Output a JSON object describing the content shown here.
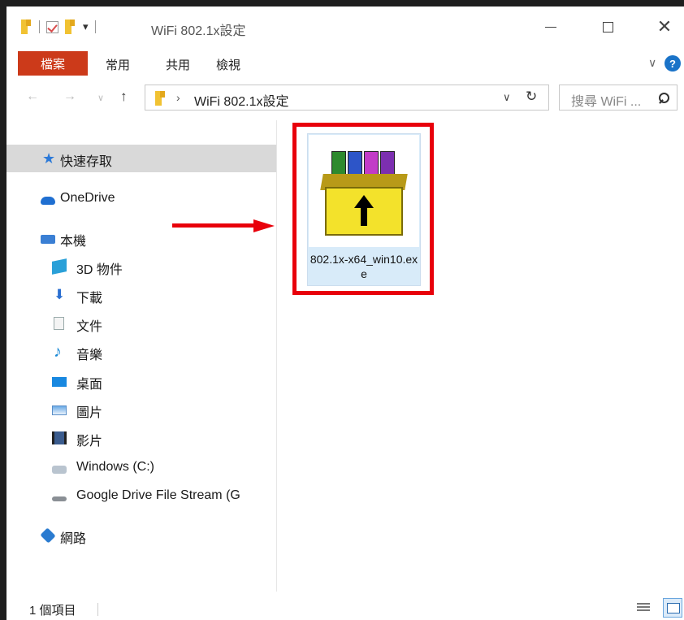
{
  "window": {
    "title": "WiFi 802.1x設定",
    "qat_dropdown": "▾",
    "min_label": "",
    "max_label": "",
    "close_label": "✕"
  },
  "ribbon": {
    "tabs": [
      "檔案",
      "常用",
      "共用",
      "檢視"
    ],
    "expand_icon": "∨",
    "help_label": "?"
  },
  "navigation": {
    "back": "←",
    "forward": "→",
    "recent": "∨",
    "up": "↑",
    "address_chevron": "›",
    "address_path": "WiFi 802.1x設定",
    "address_dropdown": "∨",
    "refresh": "↻",
    "search_placeholder": "搜尋 WiFi ..."
  },
  "nav_pane": {
    "items": [
      {
        "label": "快速存取",
        "icon": "quick-access-star-icon",
        "selected": true
      },
      {
        "label": "OneDrive",
        "icon": "onedrive-cloud-icon"
      },
      {
        "label": "本機",
        "icon": "this-pc-icon"
      },
      {
        "label": "3D 物件",
        "icon": "3d-objects-icon"
      },
      {
        "label": "下載",
        "icon": "downloads-icon"
      },
      {
        "label": "文件",
        "icon": "documents-icon"
      },
      {
        "label": "音樂",
        "icon": "music-icon"
      },
      {
        "label": "桌面",
        "icon": "desktop-icon"
      },
      {
        "label": "圖片",
        "icon": "pictures-icon"
      },
      {
        "label": "影片",
        "icon": "videos-icon"
      },
      {
        "label": "Windows (C:)",
        "icon": "drive-c-icon"
      },
      {
        "label": "Google Drive File Stream (G",
        "icon": "google-drive-icon"
      },
      {
        "label": "網路",
        "icon": "network-icon"
      }
    ]
  },
  "content": {
    "files": [
      {
        "name": "802.1x-x64_win10.exe",
        "icon": "winrar-sfx-icon"
      }
    ]
  },
  "annotation": {
    "color": "#e8000b"
  },
  "status_bar": {
    "item_count": "1 個項目"
  },
  "colors": {
    "file_tab": "#cc3a1a",
    "selection": "#d9d9d9",
    "accent": "#1a73c8"
  }
}
